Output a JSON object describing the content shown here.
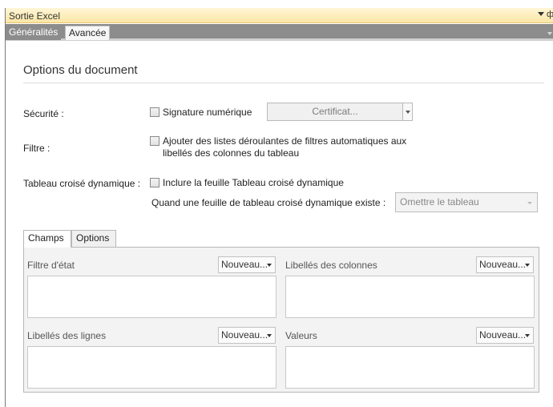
{
  "window": {
    "title": "Sortie Excel",
    "pin_glyph": "ф"
  },
  "tabs": [
    {
      "label": "Généralités"
    },
    {
      "label": "Avancée"
    }
  ],
  "section": {
    "title": "Options du document"
  },
  "security": {
    "label": "Sécurité :",
    "checkbox_label": "Signature numérique",
    "checked": false,
    "button_label": "Certificat..."
  },
  "filter": {
    "label": "Filtre :",
    "checkbox_line1": "Ajouter des listes déroulantes de filtres automatiques aux",
    "checkbox_line2": "libellés des colonnes du tableau",
    "checked": false
  },
  "pivot": {
    "label": "Tableau croisé dynamique :",
    "checkbox_label": "Inclure la feuille Tableau croisé dynamique",
    "checked": false,
    "exists_label": "Quand une feuille de tableau croisé dynamique existe :",
    "exists_value": "Omettre le tableau"
  },
  "subtabs": [
    {
      "label": "Champs"
    },
    {
      "label": "Options"
    }
  ],
  "zones": {
    "filter_state": {
      "label": "Filtre d'état",
      "button": "Nouveau..."
    },
    "column_labels": {
      "label": "Libellés des colonnes",
      "button": "Nouveau..."
    },
    "row_labels": {
      "label": "Libellés des lignes",
      "button": "Nouveau..."
    },
    "values": {
      "label": "Valeurs",
      "button": "Nouveau..."
    }
  }
}
